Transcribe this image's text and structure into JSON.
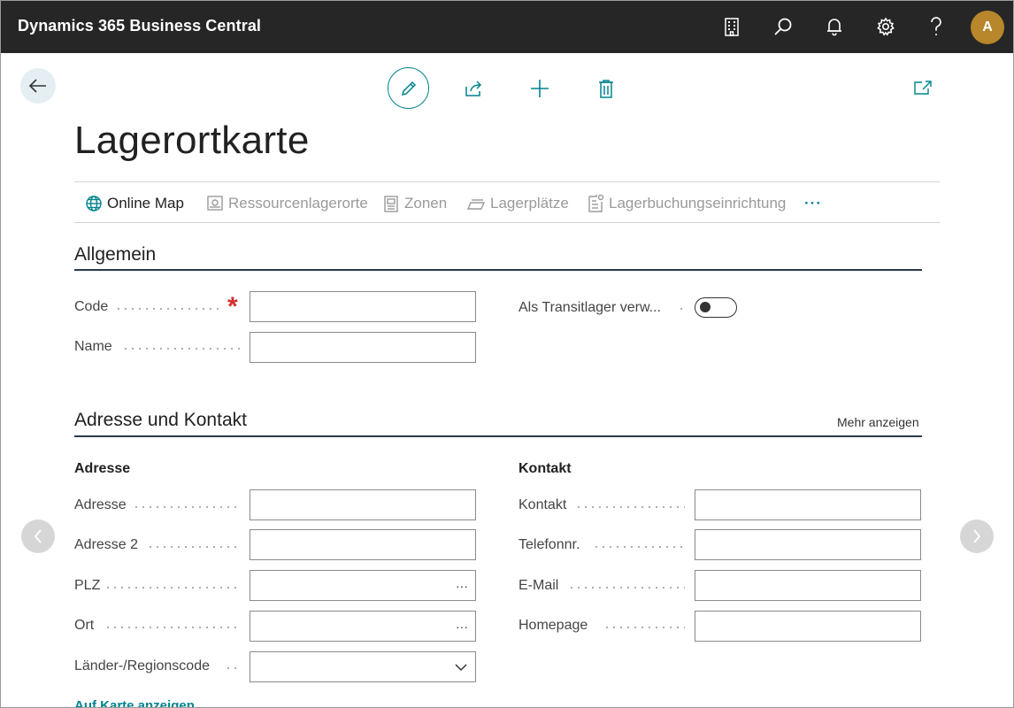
{
  "app": {
    "title": "Dynamics 365 Business Central",
    "avatar_initial": "A"
  },
  "page": {
    "title": "Lagerortkarte"
  },
  "commands": [
    {
      "label": "Online Map",
      "enabled": true,
      "icon": "globe-icon"
    },
    {
      "label": "Ressourcenlagerorte",
      "enabled": false,
      "icon": "resource-icon"
    },
    {
      "label": "Zonen",
      "enabled": false,
      "icon": "zone-icon"
    },
    {
      "label": "Lagerplätze",
      "enabled": false,
      "icon": "bin-icon"
    },
    {
      "label": "Lagerbuchungseinrichtung",
      "enabled": false,
      "icon": "setup-icon"
    }
  ],
  "more_commands": "···",
  "general": {
    "title": "Allgemein",
    "code_label": "Code",
    "name_label": "Name",
    "transit_label": "Als Transitlager verw...",
    "transit_value": false
  },
  "address_contact": {
    "title": "Adresse und Kontakt",
    "more_label": "Mehr anzeigen",
    "address_heading": "Adresse",
    "contact_heading": "Kontakt",
    "address_fields": [
      "Adresse",
      "Adresse 2",
      "PLZ",
      "Ort",
      "Länder-/Regionscode"
    ],
    "contact_fields": [
      "Kontakt",
      "Telefonnr.",
      "E-Mail",
      "Homepage"
    ],
    "lookup_symbol": "···",
    "map_link": "Auf Karte anzeigen"
  },
  "colors": {
    "accent": "#00838f",
    "topbar": "#262626",
    "avatar": "#b8862b",
    "required": "#d32f2f"
  }
}
